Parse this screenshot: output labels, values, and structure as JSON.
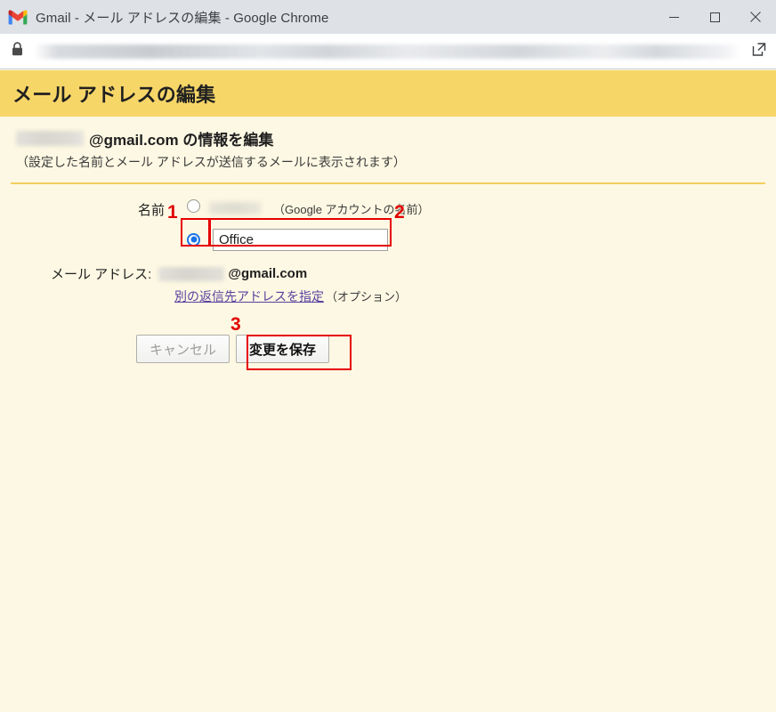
{
  "window": {
    "title": "Gmail - メール アドレスの編集 - Google Chrome",
    "app_icon": "gmail-logo-icon",
    "controls": {
      "minimize": "minimize-icon",
      "maximize": "maximize-icon",
      "close": "close-icon"
    }
  },
  "addressbar": {
    "lock_icon": "lock-icon",
    "url_value": "",
    "popout_icon": "open-in-new-icon"
  },
  "header": {
    "title": "メール アドレスの編集",
    "background_color": "#f7d668"
  },
  "subheader": {
    "account_prefix_redacted": "",
    "domain_and_text": "@gmail.com の情報を編集",
    "note": "（設定した名前とメール アドレスが送信するメールに表示されます）"
  },
  "form": {
    "name_label": "名前",
    "option_account": {
      "value_redacted": "",
      "hint": "（Google アカウントの名前）",
      "selected": false
    },
    "option_custom": {
      "input_value": "Office",
      "input_placeholder": "",
      "selected": true
    },
    "email_row": {
      "label": "メール アドレス:",
      "user_redacted": "",
      "domain": "@gmail.com"
    },
    "reply_to_link": "別の返信先アドレスを指定",
    "reply_to_option": "（オプション）",
    "buttons": {
      "cancel": "キャンセル",
      "save": "変更を保存"
    }
  },
  "annotations": {
    "color": "#e60000",
    "markers": [
      {
        "number": "1",
        "target": "custom-name-radio"
      },
      {
        "number": "2",
        "target": "custom-name-input"
      },
      {
        "number": "3",
        "target": "save-changes-button"
      }
    ]
  }
}
